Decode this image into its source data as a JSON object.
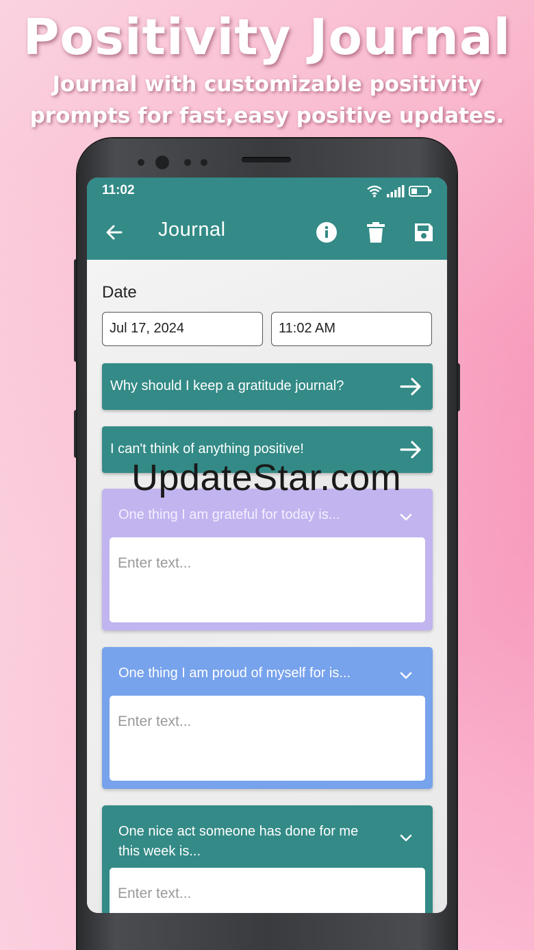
{
  "promo": {
    "title": "Positivity Journal",
    "subtitle_line1": "Journal with customizable positivity",
    "subtitle_line2": "prompts for fast,easy positive updates."
  },
  "status_bar": {
    "time": "11:02"
  },
  "app_bar": {
    "title": "Journal"
  },
  "form": {
    "date_label": "Date",
    "date_value": "Jul 17, 2024",
    "time_value": "11:02 AM"
  },
  "prompt_buttons": [
    {
      "label": "Why should I keep a gratitude journal?"
    },
    {
      "label": "I can't think of anything positive!"
    }
  ],
  "cards": [
    {
      "prompt": "One thing I am grateful for today is...",
      "placeholder": "Enter text...",
      "color": "#c2b4ef"
    },
    {
      "prompt": "One thing I am proud of myself for is...",
      "placeholder": "Enter text...",
      "color": "#77a2ec"
    },
    {
      "prompt_line1": "One nice act someone has done for me",
      "prompt_line2": "this week is...",
      "placeholder": "Enter text...",
      "color": "#338a86"
    }
  ],
  "watermark": "UpdateStar.com",
  "colors": {
    "teal": "#338a86",
    "lavender": "#c2b4ef",
    "blue": "#77a2ec"
  }
}
